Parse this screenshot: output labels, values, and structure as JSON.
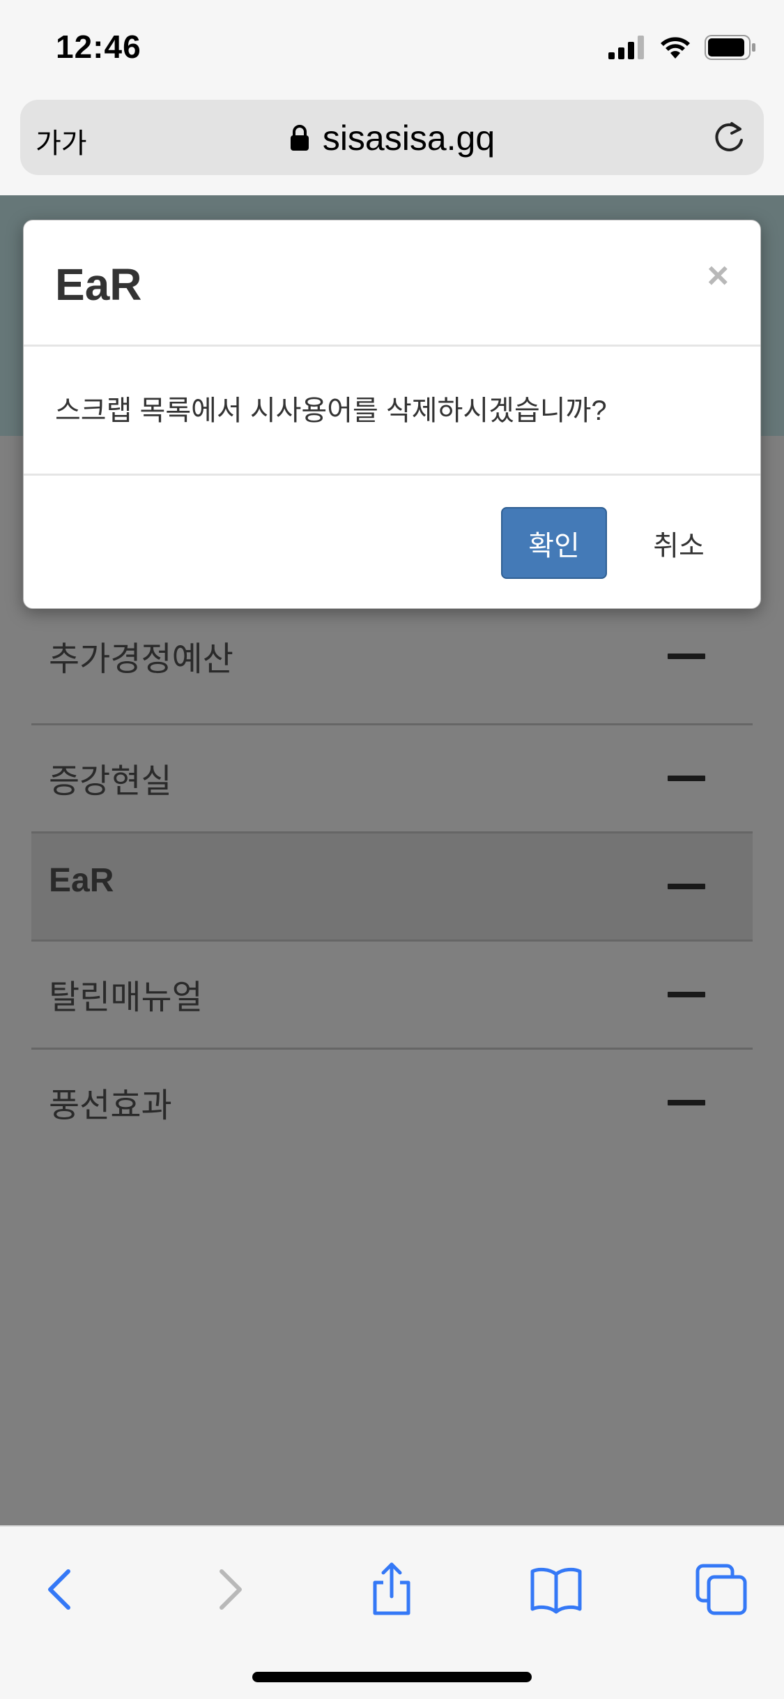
{
  "status_bar": {
    "time": "12:46"
  },
  "address_bar": {
    "text_size_label": "가가",
    "url": "sisasisa.gq"
  },
  "scrap_list": {
    "items": [
      {
        "label": "추가경정예산",
        "active": false
      },
      {
        "label": "증강현실",
        "active": false
      },
      {
        "label": "EaR",
        "active": true
      },
      {
        "label": "탈린매뉴얼",
        "active": false
      },
      {
        "label": "풍선효과",
        "active": false
      }
    ]
  },
  "modal": {
    "title": "EaR",
    "close_symbol": "×",
    "message": "스크랩 목록에서 시사용어를 삭제하시겠습니까?",
    "confirm_label": "확인",
    "cancel_label": "취소"
  },
  "colors": {
    "primary_button": "#447ab7",
    "overlay": "rgba(0,0,0,0.5)",
    "ios_blue": "#3478f6"
  },
  "toolbar": {
    "icons": [
      "back-icon",
      "forward-icon",
      "share-icon",
      "bookmarks-icon",
      "tabs-icon"
    ]
  }
}
